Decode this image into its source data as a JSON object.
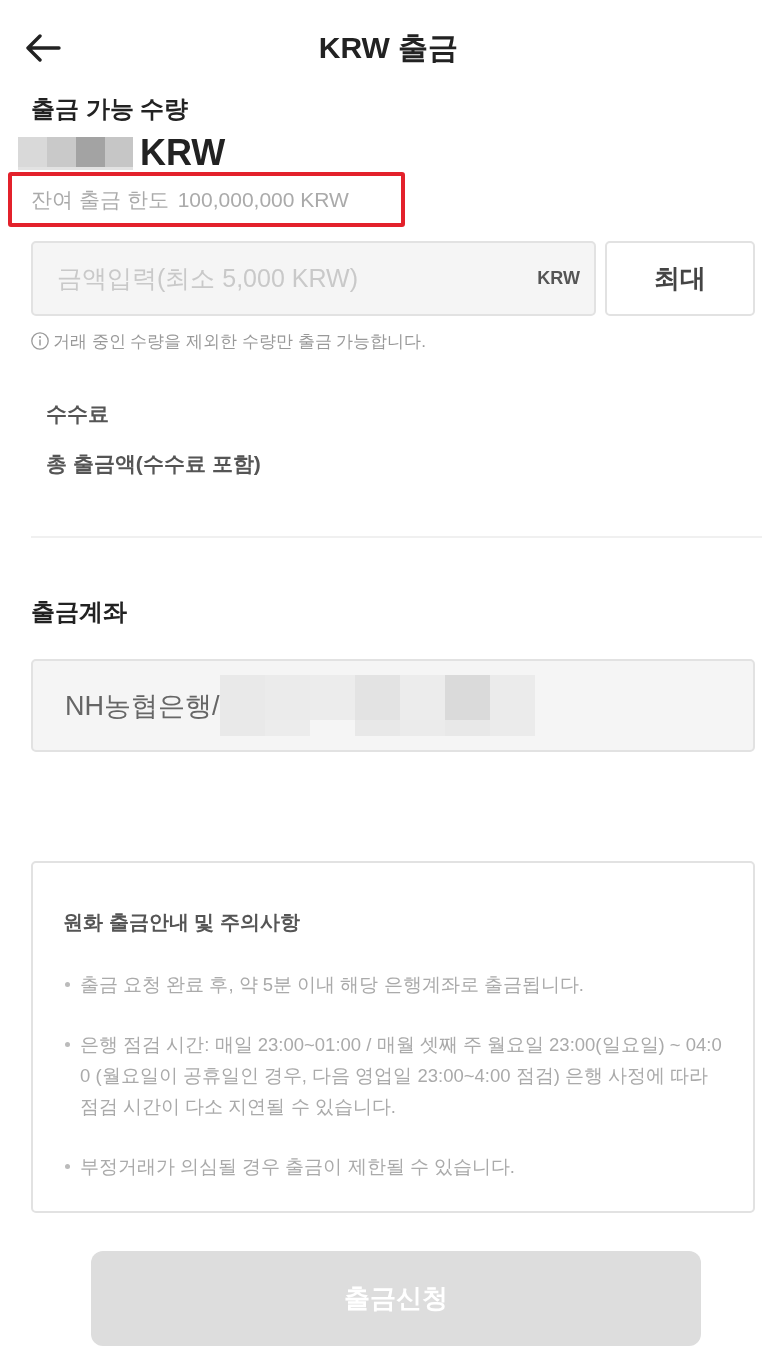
{
  "header": {
    "title": "KRW 출금"
  },
  "available": {
    "label": "출금 가능 수량",
    "unit": "KRW"
  },
  "limit": {
    "label": "잔여 출금 한도",
    "value": "100,000,000 KRW",
    "highlighted": true
  },
  "amount_input": {
    "placeholder": "금액입력(최소 5,000 KRW)",
    "unit": "KRW"
  },
  "max_button": {
    "label": "최대"
  },
  "note": "거래 중인 수량을 제외한 수량만 출금 가능합니다.",
  "fees": [
    {
      "label": "수수료"
    },
    {
      "label": "총 출금액(수수료 포함)"
    }
  ],
  "account": {
    "title": "출금계좌",
    "value": "NH농협은행/"
  },
  "notice": {
    "title": "원화 출금안내 및 주의사항",
    "items": [
      "출금 요청 완료 후, 약 5분 이내 해당 은행계좌로 출금됩니다.",
      "은행 점검 시간: 매일 23:00~01:00 / 매월 셋째 주 월요일 23:00(일요일) ~ 04:00 (월요일이 공휴일인 경우, 다음 영업일 23:00~4:00 점검) 은행 사정에 따라 점검 시간이 다소 지연될 수 있습니다.",
      "부정거래가 의심될 경우 출금이 제한될 수 있습니다."
    ]
  },
  "submit": {
    "label": "출금신청",
    "disabled": true
  }
}
